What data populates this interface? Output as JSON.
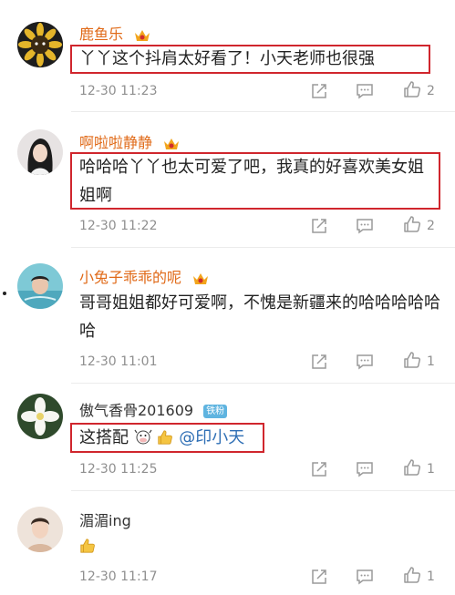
{
  "comments": [
    {
      "username": "鹿鱼乐",
      "username_color": "#e06a18",
      "has_vip_badge": true,
      "text": "丫丫这个抖肩太好看了！小天老师也很强",
      "highlighted": true,
      "time": "12-30 11:23",
      "likes": "2"
    },
    {
      "username": "啊啦啦静静",
      "username_color": "#e06a18",
      "has_vip_badge": true,
      "text": "哈哈哈丫丫也太可爱了吧，我真的好喜欢美女姐姐啊",
      "highlighted": true,
      "time": "12-30 11:22",
      "likes": "2"
    },
    {
      "username": "小兔子乖乖的呢",
      "username_color": "#e06a18",
      "has_vip_badge": true,
      "text": "哥哥姐姐都好可爱啊，不愧是新疆来的哈哈哈哈哈哈",
      "highlighted": false,
      "time": "12-30 11:01",
      "likes": "1"
    },
    {
      "username": "傲气香骨201609",
      "username_color": "#333333",
      "has_fan_badge": true,
      "fan_badge_label": "铁粉",
      "text_prefix": "这搭配",
      "emoji": [
        "cow-icon",
        "thumbs-up-icon"
      ],
      "mention": "@印小天",
      "highlighted": true,
      "time": "12-30 11:25",
      "likes": "1"
    },
    {
      "username": "湄湄ing",
      "username_color": "#333333",
      "emoji": [
        "thumbs-up-icon"
      ],
      "highlighted": false,
      "time": "12-30 11:17",
      "likes": "1"
    }
  ],
  "colors": {
    "highlight_border": "#d0262d",
    "mention": "#2f6fb5",
    "meta_gray": "#8f8f8f",
    "vip_orange": "#f2a51c",
    "fan_badge": "#5fb4e0"
  },
  "icons": {
    "repost": "share-icon",
    "comment": "comment-icon",
    "like": "thumbs-up-outline-icon"
  }
}
